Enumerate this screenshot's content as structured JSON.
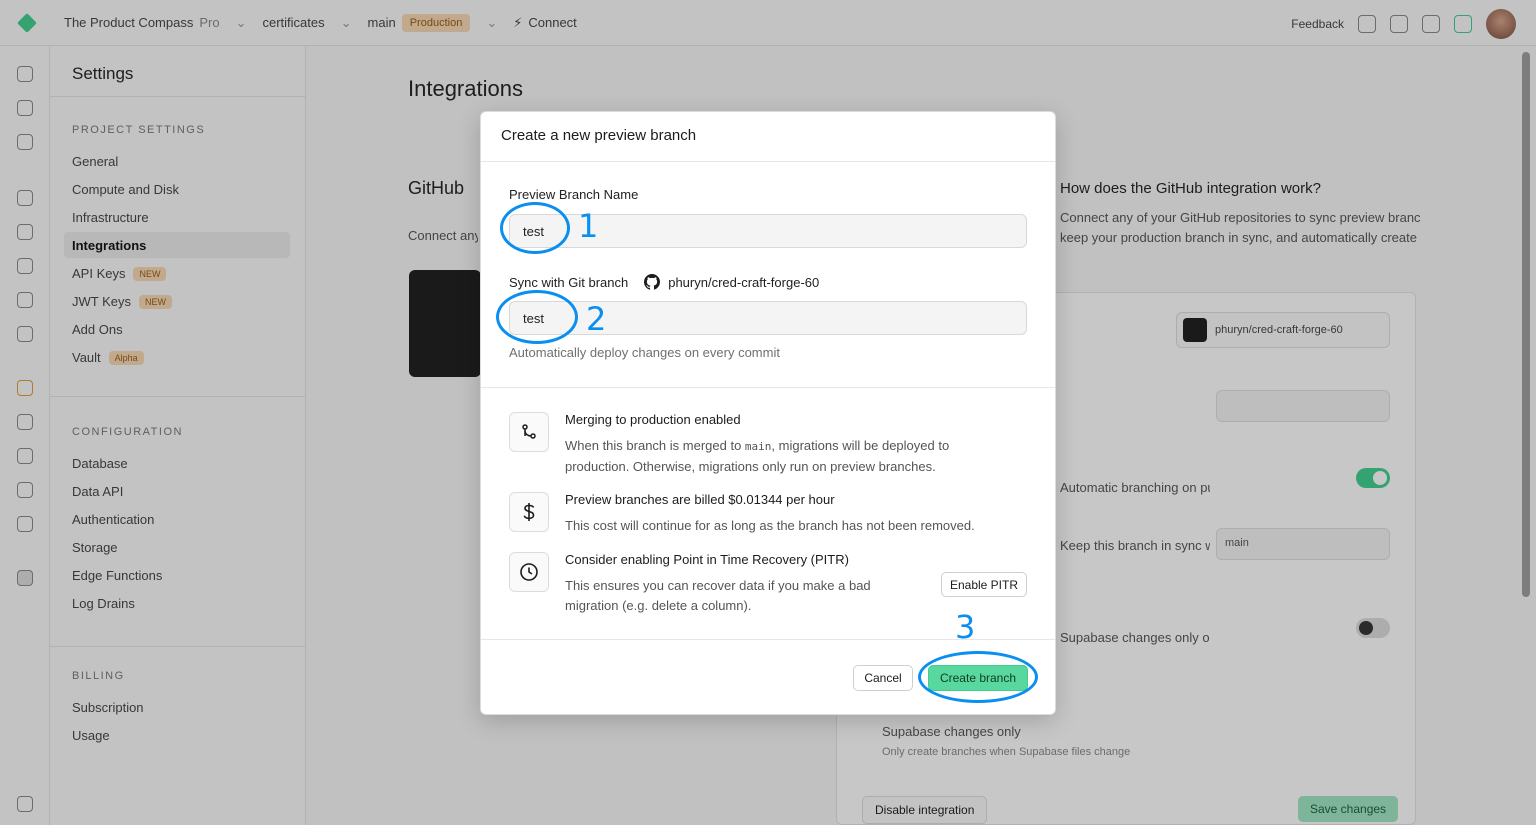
{
  "background": {
    "topbar": {
      "org": "The Product Compass",
      "plan": "Pro",
      "project": "certificates",
      "branch": "main",
      "env_badge": "Production",
      "connect": "Connect",
      "feedback": "Feedback"
    },
    "settings": {
      "title": "Settings",
      "project_section": "PROJECT SETTINGS",
      "project_items": [
        "General",
        "Compute and Disk",
        "Infrastructure",
        "Integrations",
        "API Keys",
        "JWT Keys",
        "Add Ons",
        "Vault"
      ],
      "item_badges": {
        "api_keys": "NEW",
        "jwt_keys": "NEW",
        "vault": "Alpha"
      },
      "config_section": "CONFIGURATION",
      "config_items": [
        "Database",
        "Data API",
        "Authentication",
        "Storage",
        "Edge Functions",
        "Log Drains"
      ],
      "billing_section": "BILLING",
      "billing_items": [
        "Subscription",
        "Usage"
      ]
    },
    "main": {
      "title": "Integrations",
      "section_title": "GitHub",
      "section_desc": "Connect any of your GitHub repositories to a project.",
      "side_question": "How does the GitHub integration work?",
      "side_text_1": "Connect any of your GitHub repositories to sync preview branches with a chosen GitHub branch,",
      "side_text_2": "keep your production branch in sync, and automatically create preview branches for every",
      "repo_name": "phuryn/cred-craft-forge-60",
      "row_label_automatic": "Automatic branching on push including PR merges",
      "row_label_sync": "Keep this branch in sync with your production",
      "row_label_pr": "Supabase changes only on pull request",
      "branch_value": "main",
      "deploy_label": "Supabase changes only",
      "deploy_desc": "Only create branches when Supabase files change",
      "disable_button": "Disable integration",
      "save_button": "Save changes"
    }
  },
  "modal": {
    "title": "Create a new preview branch",
    "branch_name_label": "Preview Branch Name",
    "branch_name_value": "test",
    "sync_label": "Sync with Git branch",
    "repo": "phuryn/cred-craft-forge-60",
    "git_branch_value": "test",
    "helper": "Automatically deploy changes on every commit",
    "info": [
      {
        "icon": "git-merge-icon",
        "title": "Merging to production enabled",
        "desc_before": "When this branch is merged to ",
        "desc_code": "main",
        "desc_after": ", migrations will be deployed to production. Otherwise, migrations only run on preview branches."
      },
      {
        "icon": "dollar-icon",
        "title": "Preview branches are billed $0.01344 per hour",
        "desc": "This cost will continue for as long as the branch has not been removed."
      },
      {
        "icon": "clock-icon",
        "title": "Consider enabling Point in Time Recovery (PITR)",
        "desc": "This ensures you can recover data if you make a bad migration (e.g. delete a column).",
        "action": "Enable PITR"
      }
    ],
    "cancel": "Cancel",
    "create": "Create branch"
  },
  "annotations": [
    "1",
    "2",
    "3"
  ],
  "colors": {
    "accent_green": "#3ecf8e",
    "annotation_blue": "#0a8ff0"
  }
}
